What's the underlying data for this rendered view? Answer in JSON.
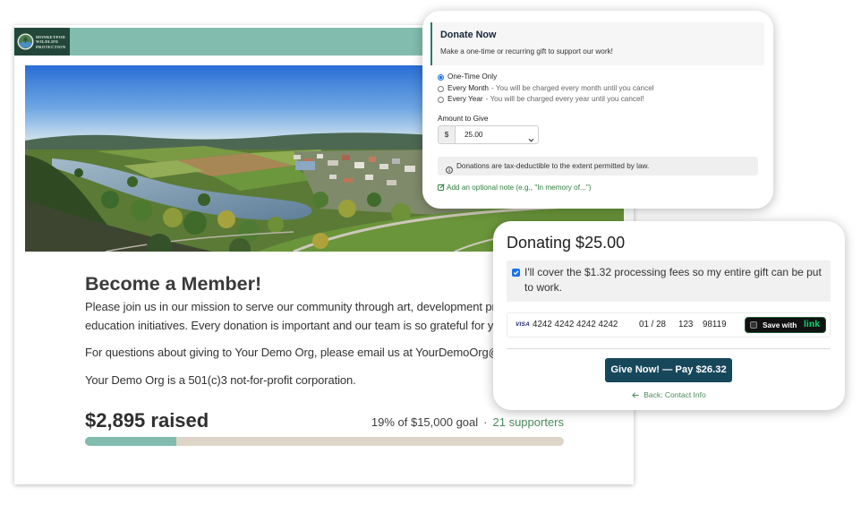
{
  "org": {
    "logo_lines": [
      "MONKEYPOD",
      "WILDLIFE",
      "PROTECTION"
    ]
  },
  "colors": {
    "header_bar": "#82bcae",
    "logo_bg": "#22473a",
    "accent_green": "#4b8a5a",
    "link_green": "#2f7d3c",
    "primary_button": "#17475b",
    "progress_fill": "#82bcae",
    "progress_track": "#ddd5c7",
    "header_rule": "#2b7a6f",
    "checkbox_blue": "#1a73e8",
    "link_brand_green": "#00d66f"
  },
  "icons": {
    "logo": "logo-emblem-icon",
    "radio": "radio-icon",
    "select": "chevron-down-icon",
    "info": "info-icon",
    "note": "edit-icon",
    "checkbox": "checkbox-icon",
    "card_brand": "visa-icon",
    "back": "arrow-left-icon"
  },
  "campaign": {
    "heading": "Become a Member!",
    "intro_lines": [
      "Please join us in our mission to serve our community through art, development pro",
      "education initiatives. Every donation is important and our team is so grateful for yo"
    ],
    "contact_line": "For questions about giving to Your Demo Org, please email us at YourDemoOrg@e",
    "legal_line": "Your Demo Org is a 501(c)3 not-for-profit corporation.",
    "raised": "$2,895 raised",
    "goal_text": "19% of $15,000 goal",
    "separator": "·",
    "supporters": "21 supporters",
    "progress_fraction": 0.19
  },
  "donate_form": {
    "title": "Donate Now",
    "subtitle": "Make a one-time or recurring gift to support our work!",
    "frequency_options": [
      {
        "label": "One-Time Only",
        "selected": true
      },
      {
        "label": "Every Month",
        "note": "- You will be charged every month until you cancel",
        "selected": false
      },
      {
        "label": "Every Year",
        "note": "- You will be charged every year until you cancel!",
        "selected": false
      }
    ],
    "amount_label": "Amount to Give",
    "currency_symbol": "$",
    "amount_value": "25.00",
    "tax_notice": "Donations are tax-deductible to the extent permitted by law.",
    "note_link": "Add an optional note (e.g., \"In memory of...\")"
  },
  "payment": {
    "title": "Donating $25.00",
    "cover_fees_checked": true,
    "cover_fees_label": "I'll cover the $1.32 processing fees so my entire gift can be put to work.",
    "card_brand": "VISA",
    "card_number": "4242 4242 4242 4242",
    "card_expiry": "01 / 28",
    "card_cvc": "123",
    "card_zip": "98119",
    "save_with_label": "Save with",
    "save_with_brand": "link",
    "submit_label": "Give Now! — Pay $26.32",
    "back_label": "Back: Contact Info"
  }
}
